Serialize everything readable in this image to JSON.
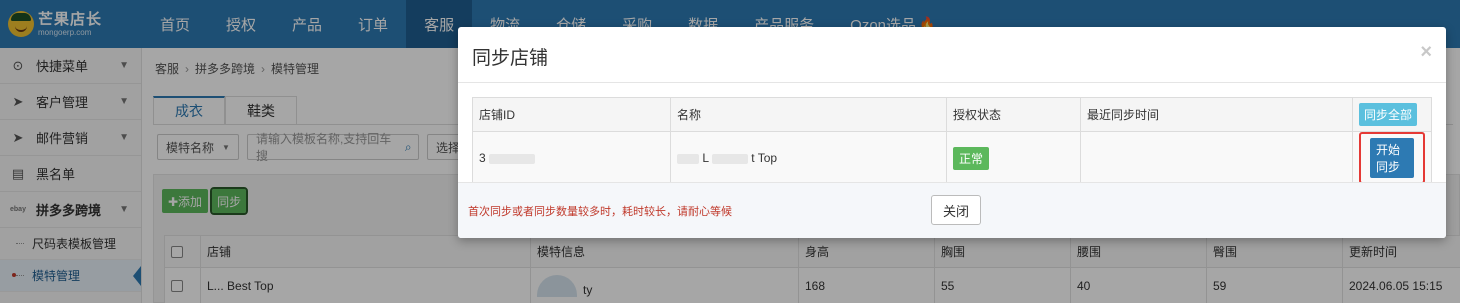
{
  "brand": {
    "title": "芒果店长",
    "subtitle": "mongoerp.com"
  },
  "topnav": {
    "items": [
      "首页",
      "授权",
      "产品",
      "订单",
      "客服",
      "物流",
      "仓储",
      "采购",
      "数据",
      "产品服务",
      "Ozon选品"
    ],
    "active": "客服"
  },
  "sidebar": {
    "items": [
      {
        "label": "快捷菜单",
        "icon": "gauge-icon"
      },
      {
        "label": "客户管理",
        "icon": "send-icon"
      },
      {
        "label": "邮件营销",
        "icon": "send-icon"
      },
      {
        "label": "黑名单",
        "icon": "document-icon"
      },
      {
        "label": "拼多多跨境",
        "icon": "ebay-icon",
        "icon_text": "ebay"
      }
    ],
    "subitems": [
      {
        "label": "尺码表模板管理"
      },
      {
        "label": "模特管理"
      }
    ]
  },
  "breadcrumb": [
    "客服",
    "拼多多跨境",
    "模特管理"
  ],
  "tabs": [
    "成衣",
    "鞋类"
  ],
  "filters": {
    "select_label": "模特名称",
    "search_placeholder": "请输入模板名称,支持回车搜",
    "store_select_label": "选择店"
  },
  "toolbar": {
    "add_label": "✚添加",
    "sync_label": "同步"
  },
  "grid": {
    "headers": [
      "店铺",
      "模特信息",
      "身高",
      "胸围",
      "腰围",
      "臀围",
      "更新时间"
    ],
    "rows": [
      {
        "store": "L... Best Top",
        "model": "ty",
        "height": "168",
        "chest": "55",
        "waist": "40",
        "hip": "59",
        "updated": "2024.06.05 15:15"
      }
    ]
  },
  "modal": {
    "title": "同步店铺",
    "close_glyph": "×",
    "headers": [
      "店铺ID",
      "名称",
      "授权状态",
      "最近同步时间"
    ],
    "sync_all_label": "同步全部",
    "rows": [
      {
        "store_id": "3",
        "name_prefix": "L",
        "name_suffix": "t Top",
        "status": "正常",
        "last_sync": "",
        "action": "开始同步"
      }
    ],
    "footer_note": "首次同步或者同步数量较多时，耗时较长，请耐心等候",
    "close_button": "关闭"
  }
}
